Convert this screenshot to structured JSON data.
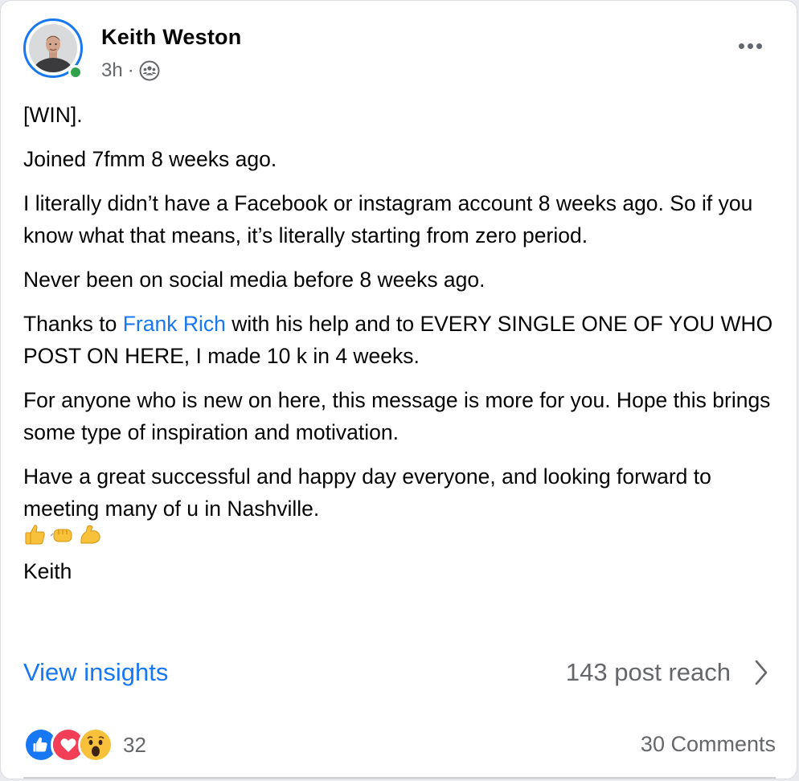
{
  "post": {
    "author": "Keith Weston",
    "time": "3h",
    "separator": "·",
    "privacy_icon": "group-icon",
    "more_icon": "more-horizontal-icon",
    "paragraphs": {
      "p1": "[WIN].",
      "p2": "Joined 7fmm 8 weeks ago.",
      "p3": "I literally didn’t have a Facebook or instagram account 8 weeks ago. So if you know what that means, it’s literally starting from zero period.",
      "p4": "Never been on social media before 8 weeks ago.",
      "p5_before": "Thanks to ",
      "p5_mention": "Frank Rich",
      "p5_after": " with his help and to EVERY SINGLE ONE OF YOU WHO POST ON HERE,  I made 10 k in 4 weeks.",
      "p6": "For anyone who is new on here, this message is more for you.  Hope this brings some type of inspiration and motivation.",
      "p7": "Have a great successful and happy day everyone, and looking forward to meeting many of u in Nashville.",
      "emojis": [
        "thumbs-up-icon",
        "fist-bump-icon",
        "flexed-biceps-icon"
      ],
      "signature": "Keith"
    }
  },
  "insights": {
    "link_label": "View insights",
    "reach": "143 post reach",
    "chevron_icon": "chevron-right-icon"
  },
  "engagement": {
    "reaction_icons": [
      "like-reaction-icon",
      "love-reaction-icon",
      "wow-reaction-icon"
    ],
    "reaction_count": "32",
    "comments": "30 Comments"
  },
  "colors": {
    "accent": "#1877f2",
    "online": "#31a24c",
    "secondary_text": "#65676b"
  }
}
